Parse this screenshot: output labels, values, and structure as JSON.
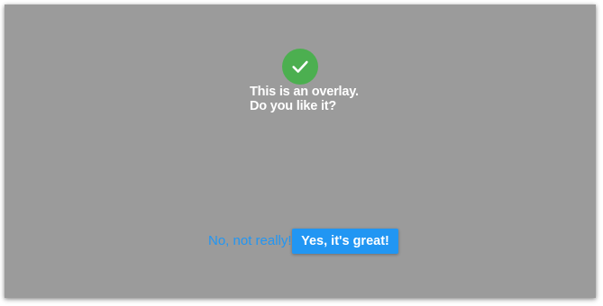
{
  "overlay": {
    "background_color": "#9b9b9b",
    "icon": {
      "name": "checkmark-icon",
      "color": "#4caf50"
    },
    "message_line1": "This is an overlay.",
    "message_line2": "Do you like it?"
  },
  "actions": {
    "decline_label": "No, not really!",
    "accept_label": "Yes, it's great!",
    "accent_color": "#2196f3"
  }
}
